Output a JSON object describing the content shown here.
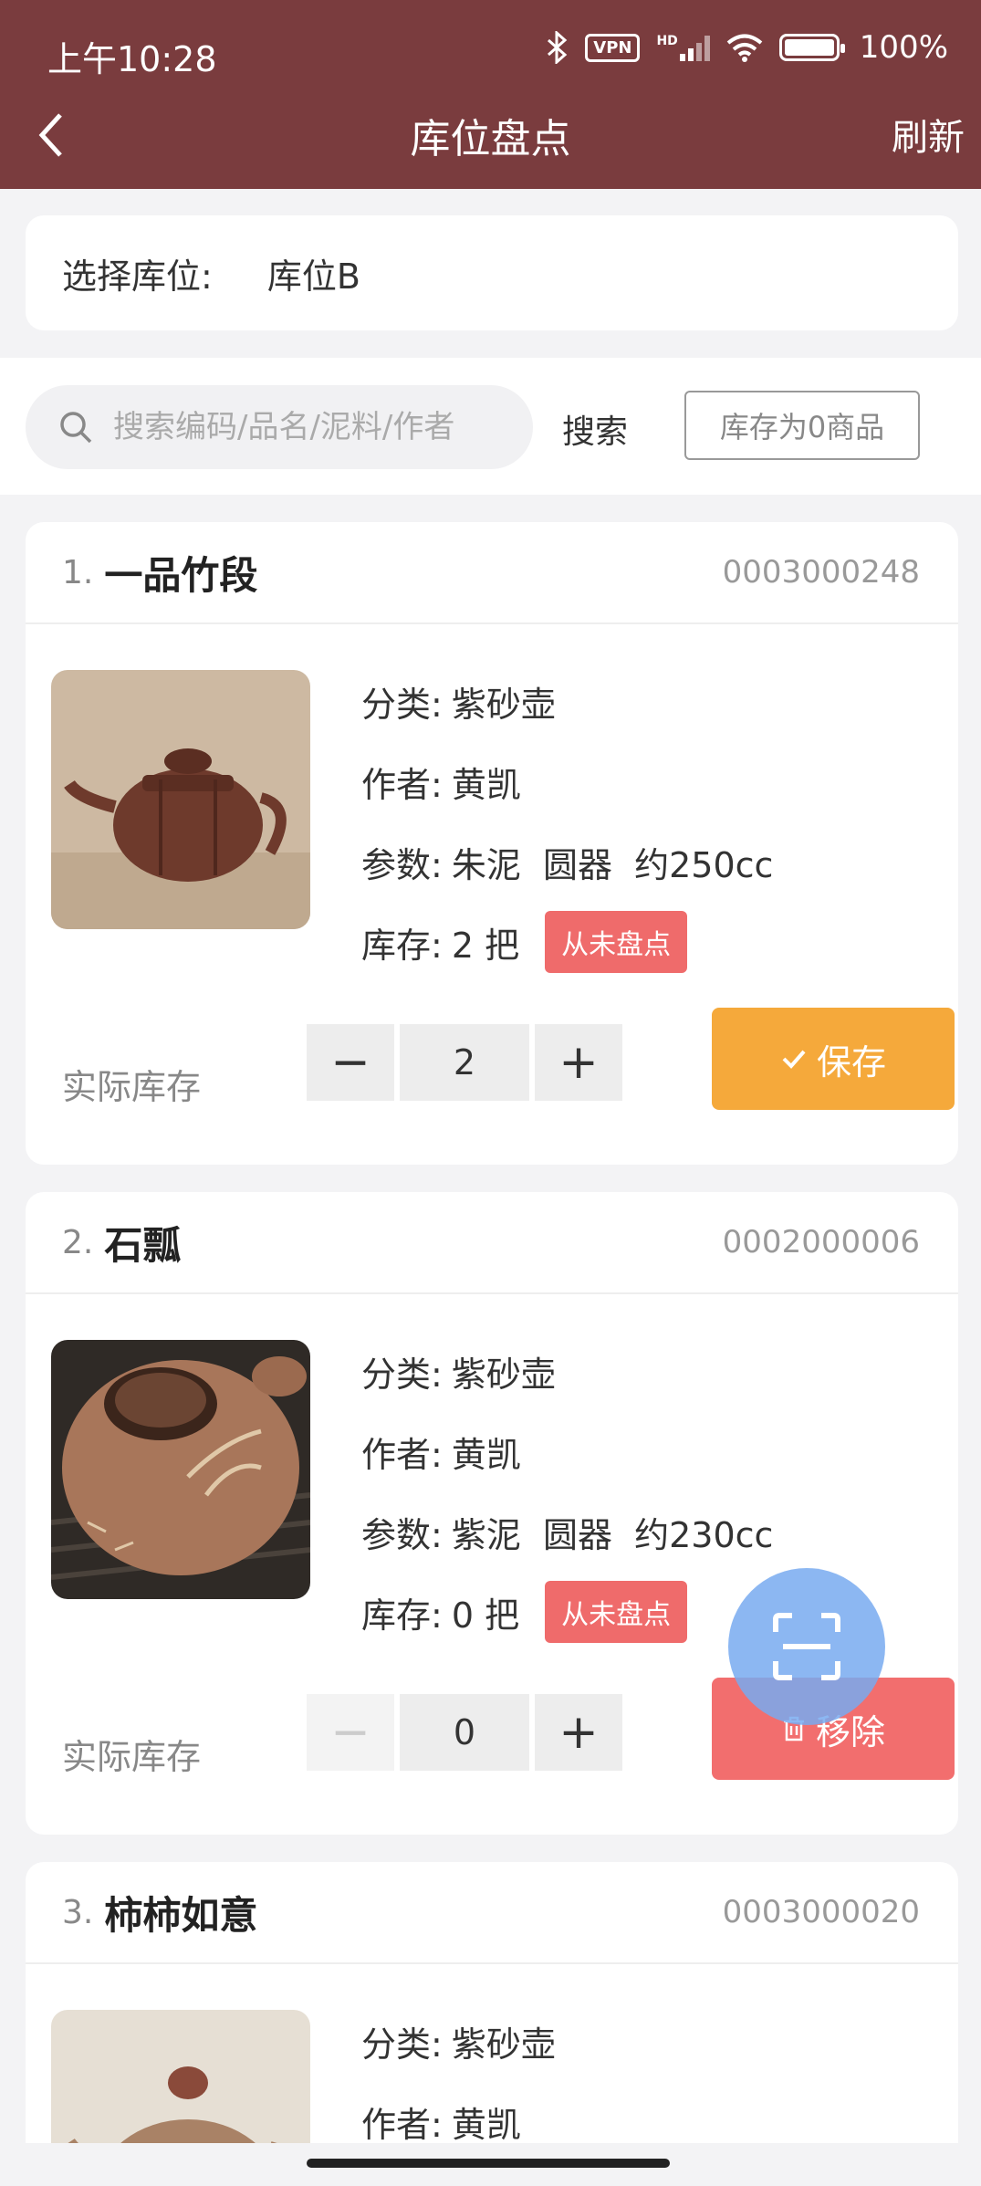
{
  "status": {
    "time": "上午10:28",
    "vpn": "VPN",
    "hd": "HD",
    "battery": "100%"
  },
  "header": {
    "title": "库位盘点",
    "refresh": "刷新"
  },
  "location": {
    "label": "选择库位:",
    "value": "库位B"
  },
  "search": {
    "placeholder": "搜索编码/品名/泥料/作者",
    "button": "搜索",
    "zero_stock": "库存为0商品"
  },
  "labels": {
    "category": "分类:",
    "author": "作者:",
    "params": "参数:",
    "stock": "库存:",
    "actual_stock": "实际库存"
  },
  "items": [
    {
      "index": "1.",
      "name": "一品竹段",
      "code": "0003000248",
      "category": "紫砂壶",
      "author": "黄凯",
      "params": "朱泥  圆器  约250cc",
      "stock": "2 把",
      "badge": "从未盘点",
      "qty": "2",
      "action": "保存",
      "action_type": "save"
    },
    {
      "index": "2.",
      "name": "石瓢",
      "code": "0002000006",
      "category": "紫砂壶",
      "author": "黄凯",
      "params": "紫泥  圆器  约230cc",
      "stock": "0 把",
      "badge": "从未盘点",
      "qty": "0",
      "action": "移除",
      "action_type": "remove"
    },
    {
      "index": "3.",
      "name": "柿柿如意",
      "code": "0003000020",
      "category": "紫砂壶",
      "author": "黄凯"
    }
  ],
  "colors": {
    "header": "#7a3c3e",
    "save": "#f5a93b",
    "remove": "#f26e6e",
    "badge": "#ef6b6b",
    "fab": "#78aaf0"
  }
}
